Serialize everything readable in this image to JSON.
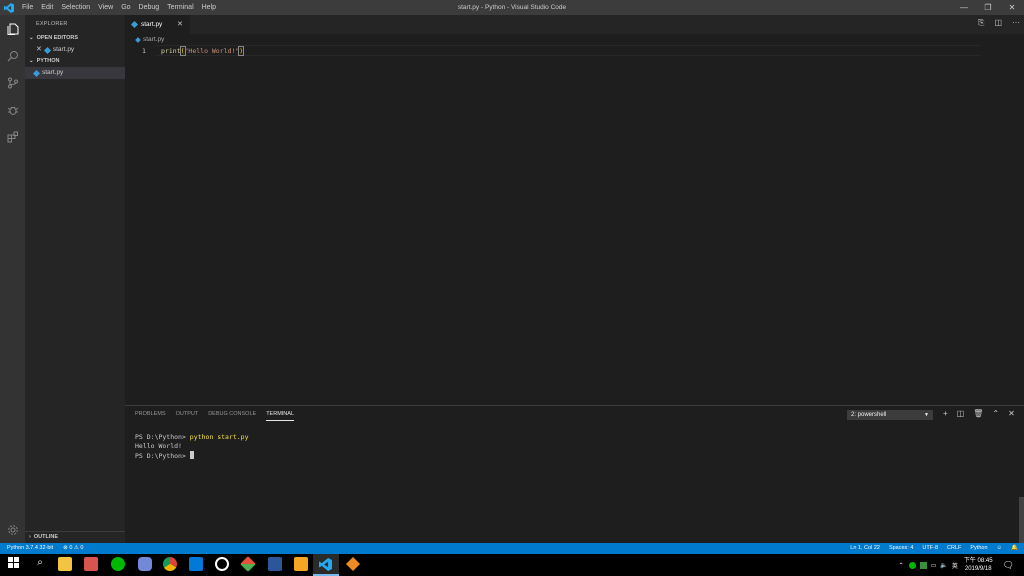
{
  "menu": [
    "File",
    "Edit",
    "Selection",
    "View",
    "Go",
    "Debug",
    "Terminal",
    "Help"
  ],
  "window_title": "start.py - Python - Visual Studio Code",
  "sidebar": {
    "title": "EXPLORER",
    "open_editors": {
      "label": "OPEN EDITORS",
      "files": [
        "start.py"
      ]
    },
    "folder": {
      "label": "PYTHON",
      "files": [
        "start.py"
      ]
    },
    "outline": "OUTLINE"
  },
  "editor": {
    "tab": "start.py",
    "breadcrumb": "start.py",
    "line_number": "1",
    "code": {
      "fn": "print",
      "open": "(",
      "str": "\"Hello World!\"",
      "close": ")"
    }
  },
  "panel": {
    "tabs": [
      "PROBLEMS",
      "OUTPUT",
      "DEBUG CONSOLE",
      "TERMINAL"
    ],
    "active_tab": "TERMINAL",
    "terminal_select": "2: powershell",
    "terminal": {
      "prompt1": "PS D:\\Python> ",
      "cmd1": "python start.py",
      "output": "Hello World!",
      "prompt2": "PS D:\\Python> "
    }
  },
  "status": {
    "interpreter": "Python 3.7.4 32-bit",
    "errors": "0",
    "warnings": "0",
    "position": "Ln 1, Col 22",
    "spaces": "Spaces: 4",
    "encoding": "UTF-8",
    "eol": "CRLF",
    "language": "Python"
  },
  "taskbar": {
    "time_prefix": "下午",
    "time": "08:45",
    "date": "2019/9/18",
    "ime": "英"
  },
  "colors": {
    "accent": "#007acc",
    "statusbar": "#007acc",
    "activitybar": "#333333",
    "sidebar": "#252526",
    "editor": "#1e1e1e"
  }
}
